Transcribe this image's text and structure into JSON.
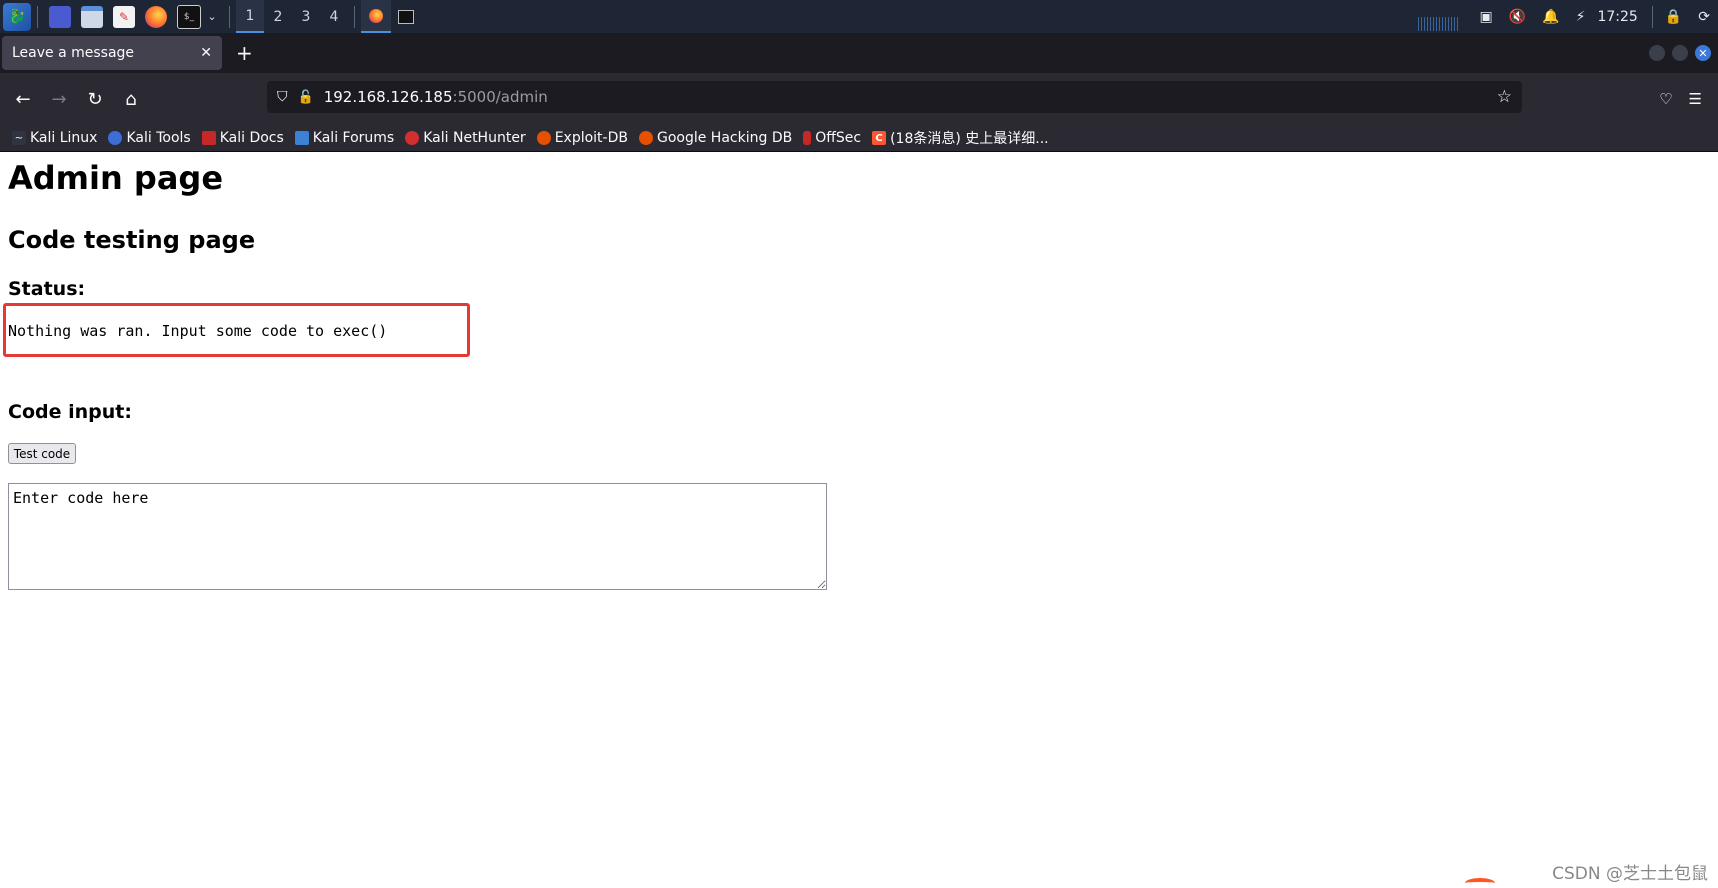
{
  "panel": {
    "workspaces": [
      "1",
      "2",
      "3",
      "4"
    ],
    "clock": "17:25"
  },
  "browser": {
    "tab_title": "Leave a message",
    "url_host": "192.168.126.185",
    "url_path": ":5000/admin",
    "bookmarks": [
      "Kali Linux",
      "Kali Tools",
      "Kali Docs",
      "Kali Forums",
      "Kali NetHunter",
      "Exploit-DB",
      "Google Hacking DB",
      "OffSec",
      "(18条消息) 史上最详细..."
    ]
  },
  "page": {
    "title": "Admin page",
    "subtitle": "Code testing page",
    "status_label": "Status:",
    "status_text": "Nothing was ran. Input some code to exec()",
    "code_label": "Code input:",
    "test_button": "Test code",
    "code_placeholder": "Enter code here"
  },
  "watermark": "CSDN @芝士土包鼠",
  "colors": {
    "panel_bg": "#1e2534",
    "toolbar_bg": "#2b2a33",
    "highlight_box": "#e53935",
    "accent": "#4a90e2"
  }
}
